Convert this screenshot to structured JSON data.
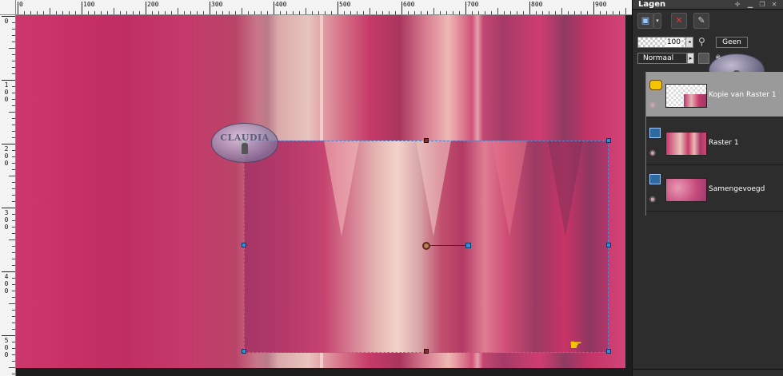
{
  "ruler": {
    "top_labels": [
      "0",
      "100",
      "200",
      "300",
      "400",
      "500",
      "600",
      "700",
      "800",
      "900"
    ],
    "left_labels": [
      "0",
      "1\n0\n0",
      "2\n0\n0",
      "3\n0\n0",
      "4\n0\n0",
      "5\n0\n0"
    ]
  },
  "watermark": {
    "text": "CLAUDIA"
  },
  "layers_panel": {
    "title": "Lagen",
    "title_buttons": [
      "pin-icon",
      "minimize-icon",
      "restore-icon",
      "close-icon"
    ],
    "opacity": "100",
    "mask_label": "Geen",
    "blend_mode": "Normaal",
    "layers": [
      {
        "name": "Kopie van Raster 1",
        "selected": true
      },
      {
        "name": "Raster 1",
        "selected": false
      },
      {
        "name": "Samengevoegd",
        "selected": false
      }
    ]
  },
  "colors": {
    "accent_pink": "#c8356a",
    "selection_blue": "#2f8fd8",
    "panel_bg": "#2d2d2d",
    "selected_row": "#9a9a9a",
    "pointer_yellow": "#f4c400"
  }
}
